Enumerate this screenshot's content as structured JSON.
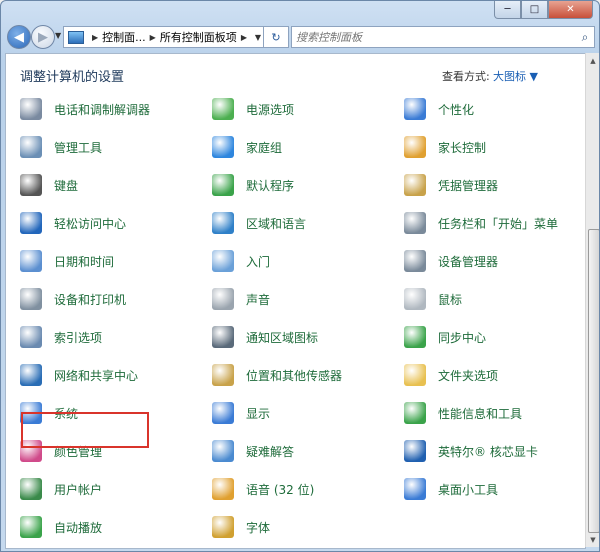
{
  "window": {
    "controls": {
      "minimize": "─",
      "maximize": "□",
      "close": "✕"
    }
  },
  "nav": {
    "back_glyph": "◀",
    "forward_glyph": "▶",
    "breadcrumb": [
      "控制面...",
      "所有控制面板项"
    ],
    "refresh_glyph": "↻",
    "search_placeholder": "搜索控制面板",
    "search_icon": "magnifier-icon"
  },
  "header": {
    "title": "调整计算机的设置",
    "view_by_label": "查看方式:",
    "view_by_value": "大图标 ▼"
  },
  "items": [
    {
      "label": "电话和调制解调器",
      "icon": "phone-modem-icon",
      "color": "#7a8aa0"
    },
    {
      "label": "电源选项",
      "icon": "power-options-icon",
      "color": "#4caf50"
    },
    {
      "label": "个性化",
      "icon": "personalization-icon",
      "color": "#3a7bd5"
    },
    {
      "label": "管理工具",
      "icon": "admin-tools-icon",
      "color": "#6b8fb5"
    },
    {
      "label": "家庭组",
      "icon": "homegroup-icon",
      "color": "#2e86de"
    },
    {
      "label": "家长控制",
      "icon": "parental-controls-icon",
      "color": "#e0a030"
    },
    {
      "label": "键盘",
      "icon": "keyboard-icon",
      "color": "#555555"
    },
    {
      "label": "默认程序",
      "icon": "default-programs-icon",
      "color": "#3aa34a"
    },
    {
      "label": "凭据管理器",
      "icon": "credential-manager-icon",
      "color": "#c8a24a"
    },
    {
      "label": "轻松访问中心",
      "icon": "ease-of-access-icon",
      "color": "#2266bb"
    },
    {
      "label": "区域和语言",
      "icon": "region-language-icon",
      "color": "#2f80c8"
    },
    {
      "label": "任务栏和「开始」菜单",
      "icon": "taskbar-start-icon",
      "color": "#7a8a9a"
    },
    {
      "label": "日期和时间",
      "icon": "date-time-icon",
      "color": "#5b8fd0"
    },
    {
      "label": "入门",
      "icon": "getting-started-icon",
      "color": "#6aa0d8"
    },
    {
      "label": "设备管理器",
      "icon": "device-manager-icon",
      "color": "#7a8a9a"
    },
    {
      "label": "设备和打印机",
      "icon": "devices-printers-icon",
      "color": "#8090a0"
    },
    {
      "label": "声音",
      "icon": "sound-icon",
      "color": "#9aa4ae"
    },
    {
      "label": "鼠标",
      "icon": "mouse-icon",
      "color": "#b0b8c0"
    },
    {
      "label": "索引选项",
      "icon": "indexing-options-icon",
      "color": "#6a8ab0"
    },
    {
      "label": "通知区域图标",
      "icon": "notification-area-icon",
      "color": "#5a6a7a"
    },
    {
      "label": "同步中心",
      "icon": "sync-center-icon",
      "color": "#3aa34a"
    },
    {
      "label": "网络和共享中心",
      "icon": "network-sharing-icon",
      "color": "#2a6db5"
    },
    {
      "label": "位置和其他传感器",
      "icon": "location-sensors-icon",
      "color": "#c8a24a"
    },
    {
      "label": "文件夹选项",
      "icon": "folder-options-icon",
      "color": "#e8c050"
    },
    {
      "label": "系统",
      "icon": "system-icon",
      "color": "#3a7bd5"
    },
    {
      "label": "显示",
      "icon": "display-icon",
      "color": "#3a7bd5"
    },
    {
      "label": "性能信息和工具",
      "icon": "performance-icon",
      "color": "#3aa34a"
    },
    {
      "label": "颜色管理",
      "icon": "color-management-icon",
      "color": "#d04a8a"
    },
    {
      "label": "疑难解答",
      "icon": "troubleshooting-icon",
      "color": "#4a8ad0"
    },
    {
      "label": "英特尔® 核芯显卡",
      "icon": "intel-graphics-icon",
      "color": "#2060b0"
    },
    {
      "label": "用户帐户",
      "icon": "user-accounts-icon",
      "color": "#3a8a4a"
    },
    {
      "label": "语音 (32 位)",
      "icon": "speech-icon",
      "color": "#e0a030"
    },
    {
      "label": "桌面小工具",
      "icon": "desktop-gadgets-icon",
      "color": "#3a7bd5"
    },
    {
      "label": "自动播放",
      "icon": "autoplay-icon",
      "color": "#3aa34a"
    },
    {
      "label": "字体",
      "icon": "fonts-icon",
      "color": "#d0a030"
    }
  ],
  "highlight_color": "#d9342b"
}
